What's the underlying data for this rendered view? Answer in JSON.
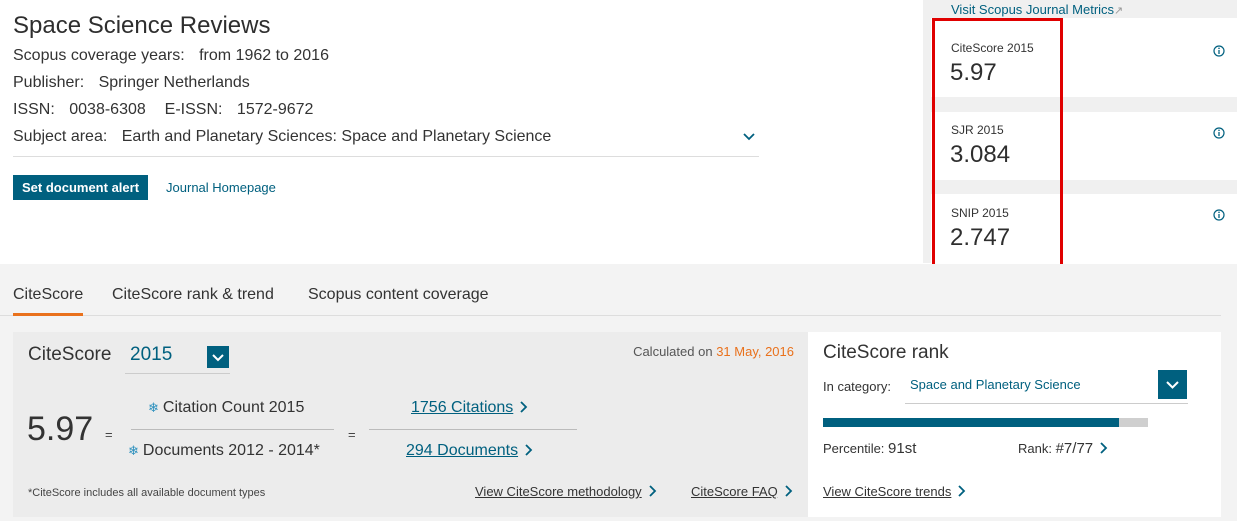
{
  "journal": {
    "title": "Space Science Reviews",
    "coverage_label": "Scopus coverage years:",
    "coverage_value": "from 1962 to 2016",
    "publisher_label": "Publisher:",
    "publisher_value": "Springer Netherlands",
    "issn_label": "ISSN:",
    "issn_value": "0038-6308",
    "eissn_label": "E-ISSN:",
    "eissn_value": "1572-9672",
    "subject_label": "Subject area:",
    "subject_value": "Earth and Planetary Sciences: Space and Planetary Science",
    "alert_button": "Set document alert",
    "homepage_link": "Journal Homepage"
  },
  "metrics": {
    "visit_link": "Visit Scopus Journal Metrics",
    "cards": [
      {
        "label": "CiteScore 2015",
        "value": "5.97"
      },
      {
        "label": "SJR 2015",
        "value": "3.084"
      },
      {
        "label": "SNIP 2015",
        "value": "2.747"
      }
    ],
    "highlight_color": "#e00000"
  },
  "tabs": [
    {
      "label": "CiteScore",
      "active": true
    },
    {
      "label": "CiteScore rank & trend",
      "active": false
    },
    {
      "label": "Scopus content coverage",
      "active": false
    }
  ],
  "citescore": {
    "title": "CiteScore",
    "year": "2015",
    "calculated_prefix": "Calculated on",
    "calculated_date": "31 May, 2016",
    "score": "5.97",
    "equals": "=",
    "numerator_label": "Citation Count 2015",
    "denominator_label": "Documents 2012 - 2014*",
    "numerator_link": "1756 Citations",
    "denominator_link": "294 Documents",
    "note": "*CiteScore includes all available document types",
    "methodology_link": "View CiteScore methodology",
    "faq_link": "CiteScore FAQ"
  },
  "rank": {
    "title": "CiteScore rank",
    "category_label": "In category:",
    "category_value": "Space and Planetary Science",
    "percentile_fraction": 0.91,
    "percentile_label": "Percentile:",
    "percentile_value": "91st",
    "rank_label": "Rank:",
    "rank_value": "#7/77",
    "trends_link": "View CiteScore trends"
  },
  "colors": {
    "accent": "#00607f",
    "orange": "#e9711c"
  }
}
